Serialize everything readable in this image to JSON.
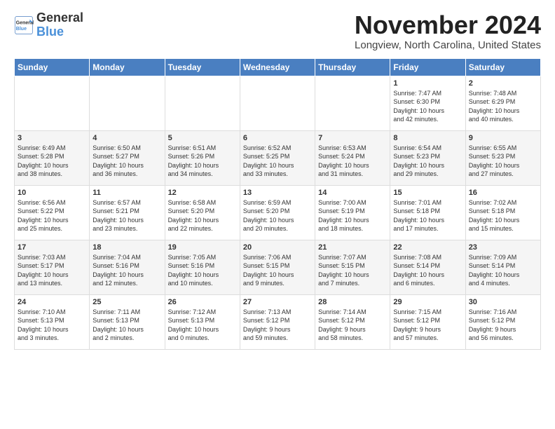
{
  "header": {
    "logo_general": "General",
    "logo_blue": "Blue",
    "month_title": "November 2024",
    "location": "Longview, North Carolina, United States"
  },
  "calendar": {
    "days_of_week": [
      "Sunday",
      "Monday",
      "Tuesday",
      "Wednesday",
      "Thursday",
      "Friday",
      "Saturday"
    ],
    "weeks": [
      [
        {
          "day": "",
          "info": ""
        },
        {
          "day": "",
          "info": ""
        },
        {
          "day": "",
          "info": ""
        },
        {
          "day": "",
          "info": ""
        },
        {
          "day": "",
          "info": ""
        },
        {
          "day": "1",
          "info": "Sunrise: 7:47 AM\nSunset: 6:30 PM\nDaylight: 10 hours\nand 42 minutes."
        },
        {
          "day": "2",
          "info": "Sunrise: 7:48 AM\nSunset: 6:29 PM\nDaylight: 10 hours\nand 40 minutes."
        }
      ],
      [
        {
          "day": "3",
          "info": "Sunrise: 6:49 AM\nSunset: 5:28 PM\nDaylight: 10 hours\nand 38 minutes."
        },
        {
          "day": "4",
          "info": "Sunrise: 6:50 AM\nSunset: 5:27 PM\nDaylight: 10 hours\nand 36 minutes."
        },
        {
          "day": "5",
          "info": "Sunrise: 6:51 AM\nSunset: 5:26 PM\nDaylight: 10 hours\nand 34 minutes."
        },
        {
          "day": "6",
          "info": "Sunrise: 6:52 AM\nSunset: 5:25 PM\nDaylight: 10 hours\nand 33 minutes."
        },
        {
          "day": "7",
          "info": "Sunrise: 6:53 AM\nSunset: 5:24 PM\nDaylight: 10 hours\nand 31 minutes."
        },
        {
          "day": "8",
          "info": "Sunrise: 6:54 AM\nSunset: 5:23 PM\nDaylight: 10 hours\nand 29 minutes."
        },
        {
          "day": "9",
          "info": "Sunrise: 6:55 AM\nSunset: 5:23 PM\nDaylight: 10 hours\nand 27 minutes."
        }
      ],
      [
        {
          "day": "10",
          "info": "Sunrise: 6:56 AM\nSunset: 5:22 PM\nDaylight: 10 hours\nand 25 minutes."
        },
        {
          "day": "11",
          "info": "Sunrise: 6:57 AM\nSunset: 5:21 PM\nDaylight: 10 hours\nand 23 minutes."
        },
        {
          "day": "12",
          "info": "Sunrise: 6:58 AM\nSunset: 5:20 PM\nDaylight: 10 hours\nand 22 minutes."
        },
        {
          "day": "13",
          "info": "Sunrise: 6:59 AM\nSunset: 5:20 PM\nDaylight: 10 hours\nand 20 minutes."
        },
        {
          "day": "14",
          "info": "Sunrise: 7:00 AM\nSunset: 5:19 PM\nDaylight: 10 hours\nand 18 minutes."
        },
        {
          "day": "15",
          "info": "Sunrise: 7:01 AM\nSunset: 5:18 PM\nDaylight: 10 hours\nand 17 minutes."
        },
        {
          "day": "16",
          "info": "Sunrise: 7:02 AM\nSunset: 5:18 PM\nDaylight: 10 hours\nand 15 minutes."
        }
      ],
      [
        {
          "day": "17",
          "info": "Sunrise: 7:03 AM\nSunset: 5:17 PM\nDaylight: 10 hours\nand 13 minutes."
        },
        {
          "day": "18",
          "info": "Sunrise: 7:04 AM\nSunset: 5:16 PM\nDaylight: 10 hours\nand 12 minutes."
        },
        {
          "day": "19",
          "info": "Sunrise: 7:05 AM\nSunset: 5:16 PM\nDaylight: 10 hours\nand 10 minutes."
        },
        {
          "day": "20",
          "info": "Sunrise: 7:06 AM\nSunset: 5:15 PM\nDaylight: 10 hours\nand 9 minutes."
        },
        {
          "day": "21",
          "info": "Sunrise: 7:07 AM\nSunset: 5:15 PM\nDaylight: 10 hours\nand 7 minutes."
        },
        {
          "day": "22",
          "info": "Sunrise: 7:08 AM\nSunset: 5:14 PM\nDaylight: 10 hours\nand 6 minutes."
        },
        {
          "day": "23",
          "info": "Sunrise: 7:09 AM\nSunset: 5:14 PM\nDaylight: 10 hours\nand 4 minutes."
        }
      ],
      [
        {
          "day": "24",
          "info": "Sunrise: 7:10 AM\nSunset: 5:13 PM\nDaylight: 10 hours\nand 3 minutes."
        },
        {
          "day": "25",
          "info": "Sunrise: 7:11 AM\nSunset: 5:13 PM\nDaylight: 10 hours\nand 2 minutes."
        },
        {
          "day": "26",
          "info": "Sunrise: 7:12 AM\nSunset: 5:13 PM\nDaylight: 10 hours\nand 0 minutes."
        },
        {
          "day": "27",
          "info": "Sunrise: 7:13 AM\nSunset: 5:12 PM\nDaylight: 9 hours\nand 59 minutes."
        },
        {
          "day": "28",
          "info": "Sunrise: 7:14 AM\nSunset: 5:12 PM\nDaylight: 9 hours\nand 58 minutes."
        },
        {
          "day": "29",
          "info": "Sunrise: 7:15 AM\nSunset: 5:12 PM\nDaylight: 9 hours\nand 57 minutes."
        },
        {
          "day": "30",
          "info": "Sunrise: 7:16 AM\nSunset: 5:12 PM\nDaylight: 9 hours\nand 56 minutes."
        }
      ]
    ]
  }
}
